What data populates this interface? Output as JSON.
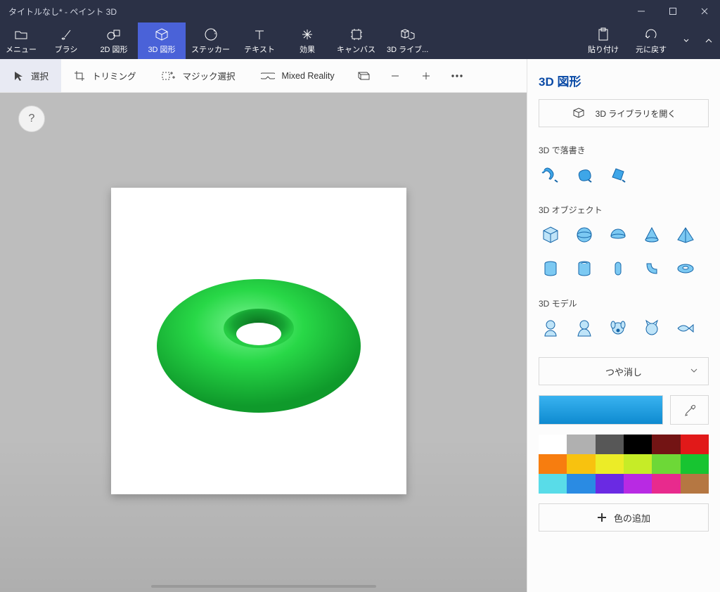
{
  "window": {
    "title": "タイトルなし* - ペイント 3D"
  },
  "ribbon": {
    "menu": "メニュー",
    "tabs": [
      "ブラシ",
      "2D 図形",
      "3D 図形",
      "ステッカー",
      "テキスト",
      "効果",
      "キャンバス",
      "3D ライブ..."
    ],
    "paste": "貼り付け",
    "undo": "元に戻す"
  },
  "toolbar": {
    "select": "選択",
    "trim": "トリミング",
    "magic": "マジック選択",
    "mixed": "Mixed Reality"
  },
  "side": {
    "title": "3D 図形",
    "open_library": "3D ライブラリを開く",
    "doodle": "3D で落書き",
    "objects": "3D オブジェクト",
    "models": "3D モデル",
    "material": "つや消し",
    "add_color": "色の追加",
    "swatches": [
      "#ffffff",
      "#b0b0b0",
      "#575757",
      "#000000",
      "#731414",
      "#e11919",
      "#f77d0f",
      "#f8c20f",
      "#ecec27",
      "#c6ec27",
      "#6dd837",
      "#17c431",
      "#59dce8",
      "#2a8be3",
      "#6a2ae3",
      "#b82ae3",
      "#e82a8d",
      "#b57742"
    ]
  },
  "help": "?"
}
